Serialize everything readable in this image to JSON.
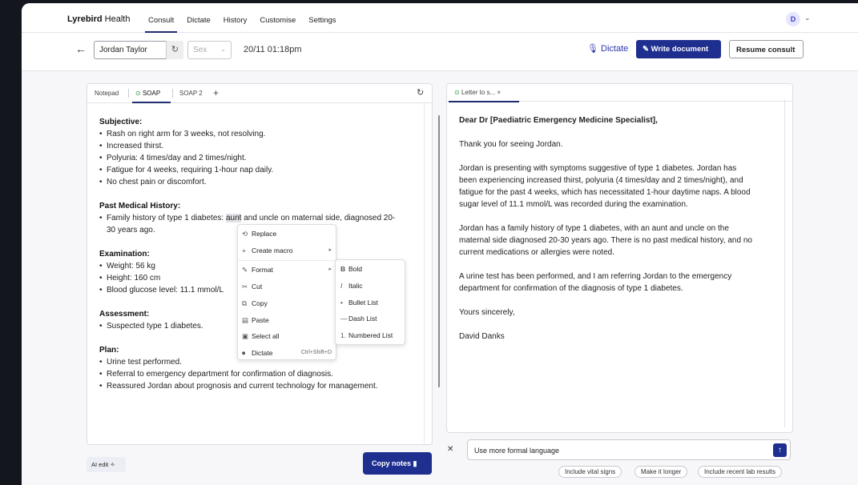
{
  "app": {
    "brand_bold": "Lyrebird",
    "brand_rest": " Health"
  },
  "nav": {
    "items": [
      "Consult",
      "Dictate",
      "History",
      "Customise",
      "Settings"
    ],
    "active": "Consult"
  },
  "user": {
    "initial": "D"
  },
  "toolbar": {
    "patient_name": "Jordan Taylor",
    "sex_placeholder": "Sex",
    "datetime": "20/11 01:18pm",
    "dictate_label": "Dictate",
    "write_document_label": "Write document",
    "resume_consult_label": "Resume consult"
  },
  "left_tabs": {
    "notepad": "Notepad",
    "soap": "SOAP",
    "soap2": "SOAP 2",
    "add": "+"
  },
  "notes": {
    "subjective_h": "Subjective:",
    "subjective": [
      "Rash on right arm for 3 weeks, not resolving.",
      "Increased thirst.",
      "Polyuria: 4 times/day and 2 times/night.",
      "Fatigue for 4 weeks, requiring 1-hour nap daily.",
      "No chest pain or discomfort."
    ],
    "pmh_h": "Past Medical History:",
    "pmh_pre": "Family history of type 1 diabetes: ",
    "pmh_hl": "aunt",
    "pmh_post": " and uncle on maternal side, diagnosed 20-",
    "pmh_line2": "30 years ago.",
    "exam_h": "Examination:",
    "exam": [
      "Weight: 56 kg",
      "Height: 160 cm",
      "Blood glucose level: 11.1 mmol/L"
    ],
    "assess_h": "Assessment:",
    "assess": [
      "Suspected type 1 diabetes."
    ],
    "plan_h": "Plan:",
    "plan": [
      "Urine test performed.",
      "Referral to emergency department for confirmation of diagnosis.",
      "Reassured Jordan about prognosis and current technology for management."
    ]
  },
  "context_menu": {
    "replace": "Replace",
    "create_macro": "Create macro",
    "format": "Format",
    "cut": "Cut",
    "copy": "Copy",
    "paste": "Paste",
    "select_all": "Select all",
    "dictate": "Dictate",
    "dictate_shortcut": "Ctrl+Shift+D"
  },
  "format_submenu": {
    "bold": "Bold",
    "italic": "Italic",
    "bullet": "Bullet List",
    "dash": "Dash List",
    "numbered": "Numbered List"
  },
  "right_tab": {
    "label": "Letter to s...",
    "close": "×"
  },
  "letter": {
    "salutation": "Dear Dr [Paediatric Emergency Medicine Specialist],",
    "p1": "Thank you for seeing Jordan.",
    "p2_lines": [
      "Jordan is presenting with symptoms suggestive of type 1 diabetes. Jordan has",
      "been experiencing increased thirst, polyuria (4 times/day and 2 times/night), and",
      "fatigue for the past 4 weeks, which has necessitated 1-hour daytime naps. A blood",
      "sugar level of 11.1 mmol/L was recorded during the examination."
    ],
    "p3_lines": [
      "Jordan has a family history of type 1 diabetes, with an aunt and uncle on the",
      "maternal side diagnosed 20-30 years ago. There is no past medical history, and no",
      "current medications or allergies were noted."
    ],
    "p4_lines": [
      "A urine test has been performed, and I am referring Jordan to the emergency",
      "department for confirmation of the diagnosis of type 1 diabetes."
    ],
    "closing": "Yours sincerely,",
    "signature": "David Danks"
  },
  "bottom": {
    "ai_edit": "AI edit",
    "copy_notes": "Copy notes",
    "ai_input_value": "Use more formal language",
    "chips": [
      "Include vital signs",
      "Make it longer",
      "Include recent lab results"
    ]
  }
}
